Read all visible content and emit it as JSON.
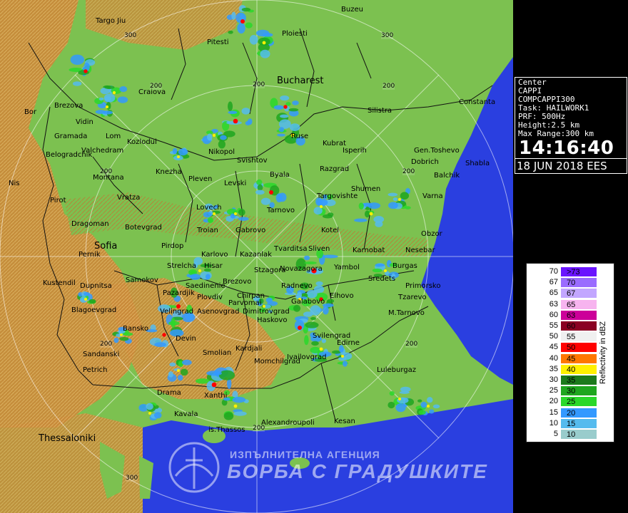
{
  "info": {
    "lines": [
      "Center",
      "CAPPI",
      "COMPCAPPI300",
      "Task: HAILWORK1",
      "PRF: 500Hz",
      "Height:2.5 km",
      "Max Range:300 km"
    ],
    "time": "14:16:40",
    "date": "18 JUN 2018 EES"
  },
  "legend": {
    "title": "Reflectivity in dBZ",
    "rows": [
      {
        "lo": "70",
        "hi": ">73",
        "color": "#6a14ff"
      },
      {
        "lo": "67",
        "hi": "70",
        "color": "#9a6cff"
      },
      {
        "lo": "65",
        "hi": "67",
        "color": "#c2a6ff"
      },
      {
        "lo": "63",
        "hi": "65",
        "color": "#f7b4ef"
      },
      {
        "lo": "60",
        "hi": "63",
        "color": "#cc0099"
      },
      {
        "lo": "55",
        "hi": "60",
        "color": "#8a0022"
      },
      {
        "lo": "50",
        "hi": "55",
        "color": "#f0f0f0"
      },
      {
        "lo": "45",
        "hi": "50",
        "color": "#ff0000"
      },
      {
        "lo": "40",
        "hi": "45",
        "color": "#ff7700"
      },
      {
        "lo": "35",
        "hi": "40",
        "color": "#fff000"
      },
      {
        "lo": "30",
        "hi": "35",
        "color": "#1c7a1c"
      },
      {
        "lo": "25",
        "hi": "30",
        "color": "#1fa61f"
      },
      {
        "lo": "20",
        "hi": "25",
        "color": "#2ad82a"
      },
      {
        "lo": "15",
        "hi": "20",
        "color": "#3399ff"
      },
      {
        "lo": "10",
        "hi": "15",
        "color": "#55bbee"
      },
      {
        "lo": "5",
        "hi": "10",
        "color": "#99cccc"
      }
    ]
  },
  "map": {
    "colors": {
      "sea": "#2a3fe0",
      "lowland": "#7cc150",
      "mountain": "#c98a3a",
      "border": "#111111"
    },
    "cities": [
      {
        "name": "Buzeu"
      },
      {
        "name": "Targo Jiu"
      },
      {
        "name": "Ploiesti"
      },
      {
        "name": "Pitesti"
      },
      {
        "name": "Bucharest"
      },
      {
        "name": "Craiova"
      },
      {
        "name": "Constanta"
      },
      {
        "name": "Brezova"
      },
      {
        "name": "Silistra"
      },
      {
        "name": "Bor"
      },
      {
        "name": "Vidin"
      },
      {
        "name": "Lom"
      },
      {
        "name": "Gramada"
      },
      {
        "name": "Kozlodui"
      },
      {
        "name": "Ruse"
      },
      {
        "name": "Kubrat"
      },
      {
        "name": "Belogradchik"
      },
      {
        "name": "Valchedram"
      },
      {
        "name": "Nikopol"
      },
      {
        "name": "Isperih"
      },
      {
        "name": "Gen.Toshevo"
      },
      {
        "name": "Svishtov"
      },
      {
        "name": "Dobrich"
      },
      {
        "name": "Shabla"
      },
      {
        "name": "Knezha"
      },
      {
        "name": "Byala"
      },
      {
        "name": "Razgrad"
      },
      {
        "name": "Balchik"
      },
      {
        "name": "Nis"
      },
      {
        "name": "Montana"
      },
      {
        "name": "Pleven"
      },
      {
        "name": "Levski"
      },
      {
        "name": "Shumen"
      },
      {
        "name": "Targovishte"
      },
      {
        "name": "Varna"
      },
      {
        "name": "Vratza"
      },
      {
        "name": "Pirot"
      },
      {
        "name": "Lovech"
      },
      {
        "name": "Tarnovo"
      },
      {
        "name": "Dragoman"
      },
      {
        "name": "Botevgrad"
      },
      {
        "name": "Troian"
      },
      {
        "name": "Gabrovo"
      },
      {
        "name": "Kotel"
      },
      {
        "name": "Obzor"
      },
      {
        "name": "Sofia"
      },
      {
        "name": "Pirdop"
      },
      {
        "name": "Karlovo"
      },
      {
        "name": "Kazanlak"
      },
      {
        "name": "Tvarditsa"
      },
      {
        "name": "Sliven"
      },
      {
        "name": "Karnobat"
      },
      {
        "name": "Nesebar"
      },
      {
        "name": "Pernik"
      },
      {
        "name": "Strelcha"
      },
      {
        "name": "Hisar"
      },
      {
        "name": "Stzagora"
      },
      {
        "name": "Novazagora"
      },
      {
        "name": "Yambol"
      },
      {
        "name": "Burgas"
      },
      {
        "name": "Kustendil"
      },
      {
        "name": "Samokov"
      },
      {
        "name": "Sredets"
      },
      {
        "name": "Dupnitsa"
      },
      {
        "name": "Saedinenie"
      },
      {
        "name": "Brezovo"
      },
      {
        "name": "Radnevo"
      },
      {
        "name": "Primorsko"
      },
      {
        "name": "Pazardjik"
      },
      {
        "name": "Plovdiv"
      },
      {
        "name": "Chirpan"
      },
      {
        "name": "Elhovo"
      },
      {
        "name": "Tzarevo"
      },
      {
        "name": "Blagoevgrad"
      },
      {
        "name": "Velingrad"
      },
      {
        "name": "Asenovgrad"
      },
      {
        "name": "Parvomai"
      },
      {
        "name": "Dimitrovgrad"
      },
      {
        "name": "Galabovo"
      },
      {
        "name": "M.Tarnovo"
      },
      {
        "name": "Haskovo"
      },
      {
        "name": "Bansko"
      },
      {
        "name": "Devin"
      },
      {
        "name": "Svilengrad"
      },
      {
        "name": "Edirne"
      },
      {
        "name": "Kardjali"
      },
      {
        "name": "Sandanski"
      },
      {
        "name": "Smolian"
      },
      {
        "name": "Momchilgrad"
      },
      {
        "name": "Ivailovgrad"
      },
      {
        "name": "Luleburgaz"
      },
      {
        "name": "Petrich"
      },
      {
        "name": "Xanthi"
      },
      {
        "name": "Drama"
      },
      {
        "name": "Alexandroupoli"
      },
      {
        "name": "Kesan"
      },
      {
        "name": "Kavala"
      },
      {
        "name": "is.Thassos"
      },
      {
        "name": "Thessaloniki"
      }
    ],
    "ring_labels": [
      "300",
      "300",
      "200",
      "200",
      "200",
      "200",
      "200",
      "200",
      "200",
      "200",
      "300"
    ]
  },
  "logo": {
    "line1": "ИЗПЪЛНИТЕЛНА АГЕНЦИЯ",
    "line2": "БОРБА С ГРАДУШКИТЕ"
  }
}
